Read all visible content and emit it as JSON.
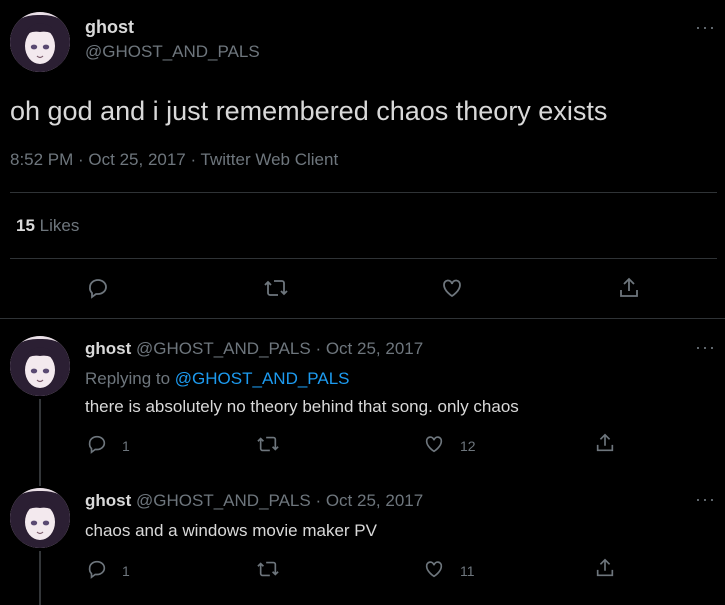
{
  "main_tweet": {
    "display_name": "ghost",
    "handle": "@GHOST_AND_PALS",
    "text": "oh god and i just remembered chaos theory exists",
    "meta": "8:52 PM · Oct 25, 2017 · Twitter Web Client",
    "likes_count": "15",
    "likes_label": "Likes"
  },
  "replies": [
    {
      "display_name": "ghost",
      "handle_date": "@GHOST_AND_PALS · Oct 25, 2017",
      "replying_prefix": "Replying to",
      "replying_to": "@GHOST_AND_PALS",
      "text": "there is absolutely no theory behind that song. only chaos",
      "reply_count": "1",
      "like_count": "12"
    },
    {
      "display_name": "ghost",
      "handle_date": "@GHOST_AND_PALS · Oct 25, 2017",
      "text": "chaos and a windows movie maker PV",
      "reply_count": "1",
      "like_count": "11"
    }
  ],
  "more_label": "···",
  "icons": [
    "reply-icon",
    "retweet-icon",
    "like-icon",
    "share-icon",
    "more-icon"
  ],
  "colors": {
    "background": "#000000",
    "text": "#d9d9d9",
    "muted": "#6e767d",
    "link": "#1d9bf0",
    "divider": "#2f3336"
  }
}
